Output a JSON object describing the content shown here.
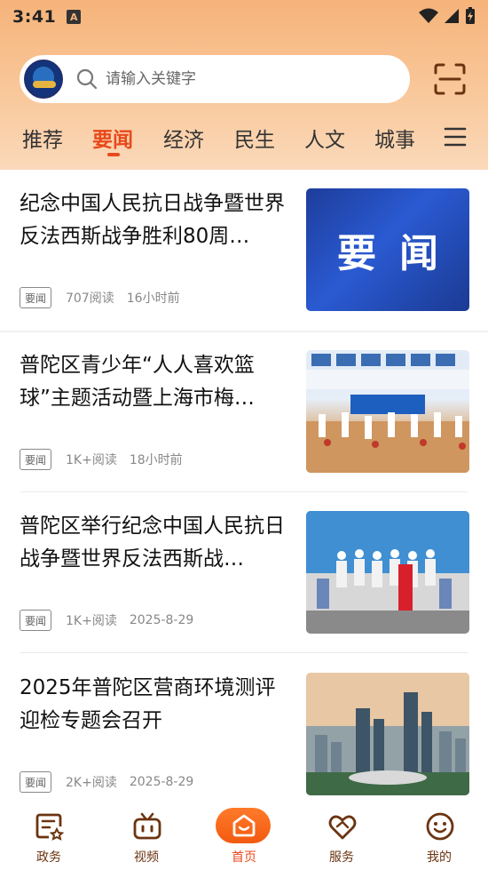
{
  "status_bar": {
    "time": "3:41",
    "notification_icon": "A"
  },
  "search": {
    "placeholder": "请输入关键字"
  },
  "tabs": [
    {
      "label": "推荐",
      "active": false
    },
    {
      "label": "要闻",
      "active": true
    },
    {
      "label": "经济",
      "active": false
    },
    {
      "label": "民生",
      "active": false
    },
    {
      "label": "人文",
      "active": false
    },
    {
      "label": "城事",
      "active": false
    }
  ],
  "news": [
    {
      "title": "纪念中国人民抗日战争暨世界反法西斯战争胜利80周…",
      "tag": "要闻",
      "reads": "707阅读",
      "time": "16小时前",
      "thumb_text": "要闻"
    },
    {
      "title": "普陀区青少年“人人喜欢篮球”主题活动暨上海市梅…",
      "tag": "要闻",
      "reads": "1K+阅读",
      "time": "18小时前"
    },
    {
      "title": "普陀区举行纪念中国人民抗日战争暨世界反法西斯战…",
      "tag": "要闻",
      "reads": "1K+阅读",
      "time": "2025-8-29"
    },
    {
      "title": "2025年普陀区营商环境测评迎检专题会召开",
      "tag": "要闻",
      "reads": "2K+阅读",
      "time": "2025-8-29"
    }
  ],
  "bottom_nav": [
    {
      "label": "政务",
      "icon": "document-star-icon"
    },
    {
      "label": "视频",
      "icon": "tv-icon"
    },
    {
      "label": "首页",
      "icon": "home-icon",
      "active": true
    },
    {
      "label": "服务",
      "icon": "heart-hands-icon"
    },
    {
      "label": "我的",
      "icon": "smiley-icon"
    }
  ],
  "colors": {
    "accent": "#e8491b",
    "header_gradient_top": "#f6b37a",
    "nav_text": "#6b3410"
  }
}
